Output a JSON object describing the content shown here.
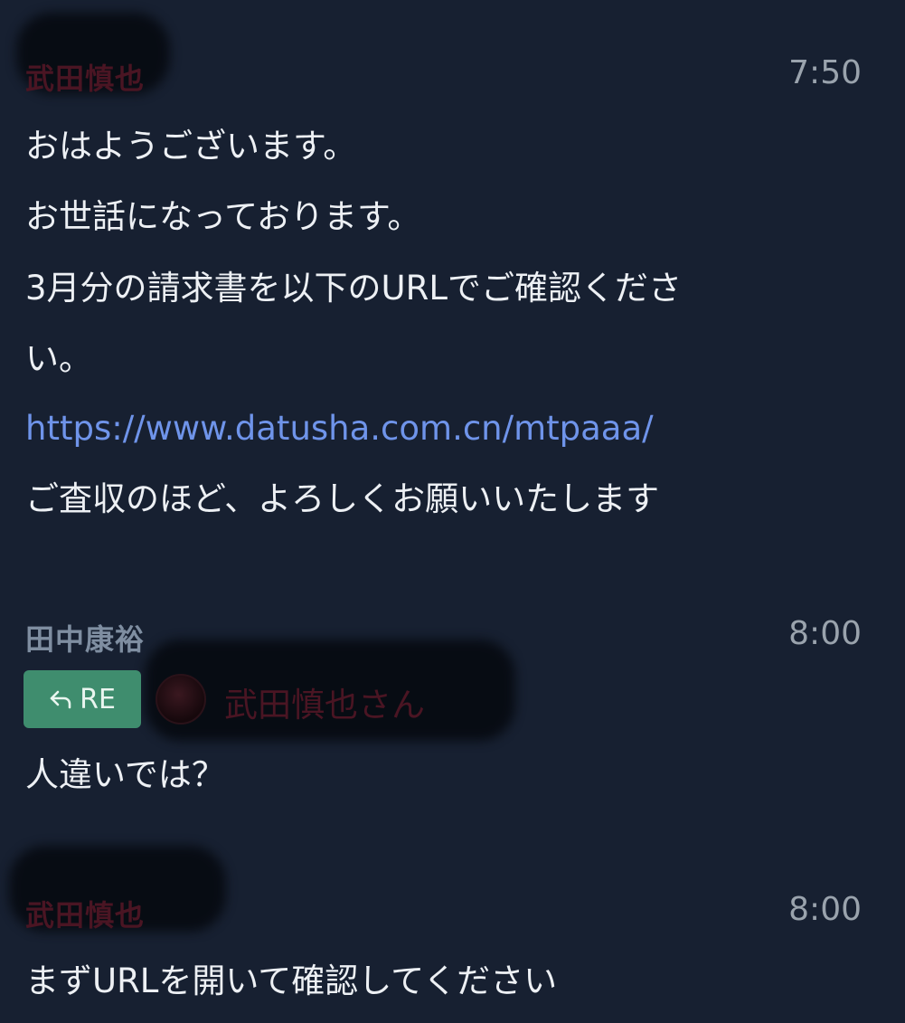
{
  "messages": [
    {
      "sender": "武田慎也",
      "time": "7:50",
      "lines": [
        "おはようございます。",
        "お世話になっております。",
        "3月分の請求書を以下のURLでご確認くださ",
        "い。"
      ],
      "link": "https://www.datusha.com.cn/mtpaaa/",
      "closing": "ご査収のほど、よろしくお願いいたします"
    },
    {
      "sender": "田中康裕",
      "time": "8:00",
      "reply": {
        "button_label": "RE",
        "icon": "reply-arrow-icon",
        "target": "武田慎也さん"
      },
      "lines": [
        "人違いでは？"
      ]
    },
    {
      "sender": "武田慎也",
      "time": "8:00",
      "lines": [
        "まずURLを開いて確認してください"
      ]
    }
  ],
  "colors": {
    "background": "#172031",
    "link": "#6f94ea",
    "reply_button": "#3f8d6e",
    "redacted_name": "#4a1523"
  }
}
